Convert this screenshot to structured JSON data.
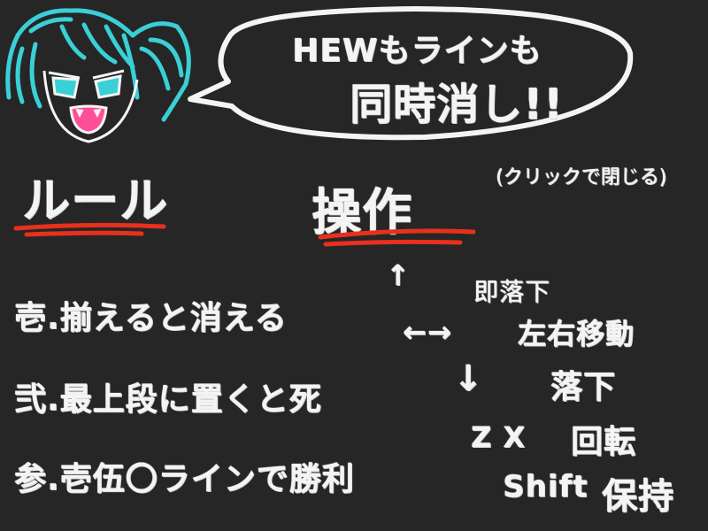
{
  "speech_bubble": {
    "line1": "HEWもラインも",
    "line2": "同時消し!!"
  },
  "close_hint": "(クリックで閉じる)",
  "rules": {
    "heading": "ルール",
    "items": [
      "壱.揃えると消える",
      "弐.最上段に置くと死",
      "参.壱伍〇ラインで勝利"
    ]
  },
  "controls": {
    "heading": "操作",
    "items": [
      {
        "key": "↑",
        "action": "即落下"
      },
      {
        "key": "←→",
        "action": "左右移動"
      },
      {
        "key": "↓",
        "action": "落下"
      },
      {
        "key": "Z X",
        "action": "回転"
      },
      {
        "key": "Shift",
        "action": "保持"
      }
    ]
  },
  "colors": {
    "background": "#262626",
    "chalk": "#f4f4f4",
    "underline": "#e8301c",
    "hair": "#39d0d6",
    "mouth": "#ff4f9a"
  }
}
